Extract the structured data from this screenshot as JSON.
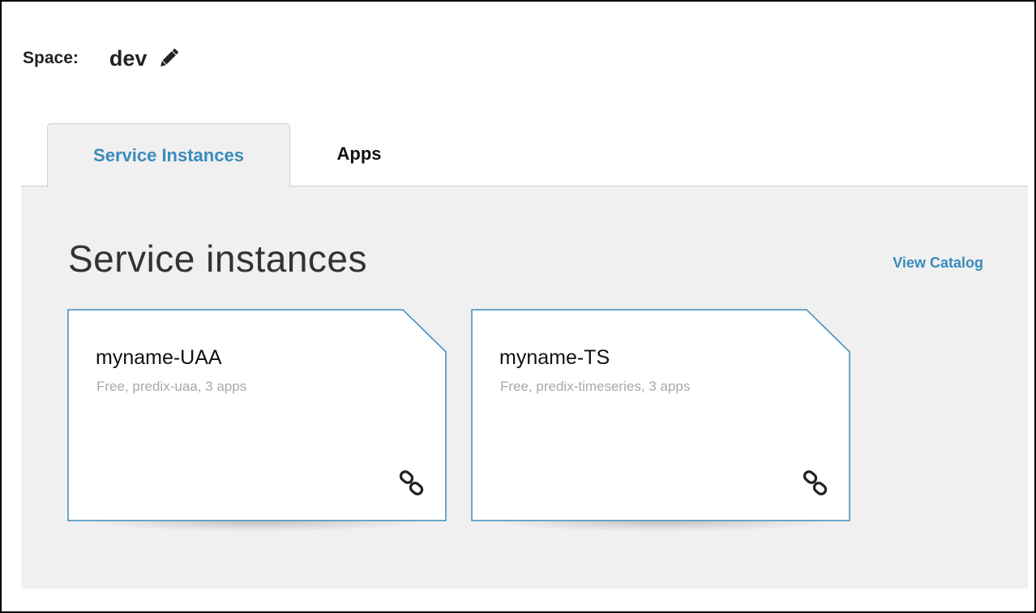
{
  "header": {
    "space_label": "Space:",
    "space_name": "dev",
    "edit_icon": "pencil-icon"
  },
  "tabs": [
    {
      "label": "Service Instances",
      "active": true
    },
    {
      "label": "Apps",
      "active": false
    }
  ],
  "main": {
    "title": "Service instances",
    "view_catalog_label": "View Catalog",
    "cards": [
      {
        "name": "myname-UAA",
        "details": "Free, predix-uaa, 3 apps",
        "icon": "link-icon"
      },
      {
        "name": "myname-TS",
        "details": "Free, predix-timeseries, 3 apps",
        "icon": "link-icon"
      }
    ]
  },
  "colors": {
    "accent": "#3a8bbd",
    "panel_background": "#f0f0f0",
    "card_border": "#3a8bbd"
  }
}
